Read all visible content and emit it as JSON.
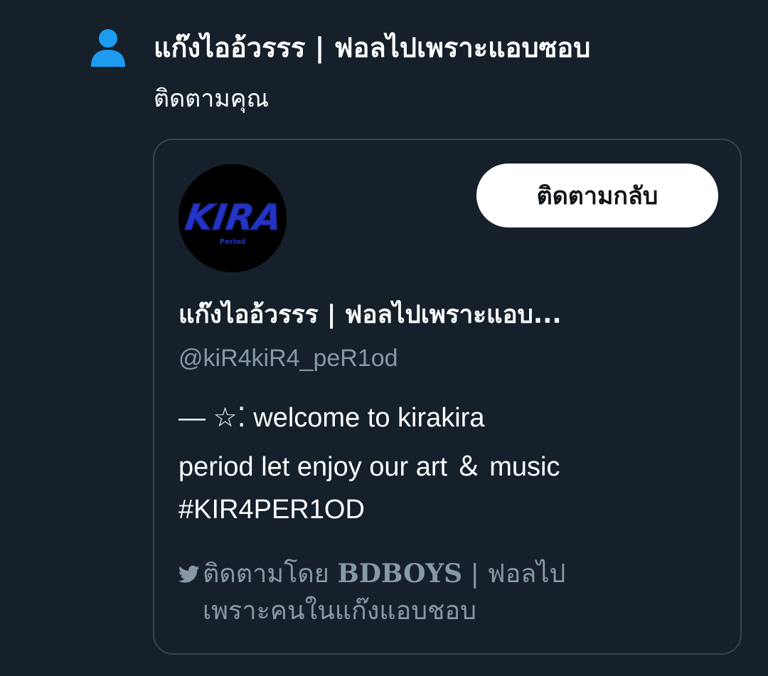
{
  "notification": {
    "icon": "person-icon",
    "icon_color": "#1d9bf0",
    "title": "แก๊งไออ้วรรร | ฟอลไปเพราะแอบซอบ",
    "subtitle": "ติดตามคุณ"
  },
  "card": {
    "avatar_text": "KIRA",
    "avatar_subtext": "Period",
    "avatar_text_color": "#2433c8",
    "follow_back_label": "ติดตามกลับ",
    "display_name": "แก๊งไออ้วรรร | ฟอลไปเพราะแอบ...",
    "handle": "@kiR4kiR4_peR1od",
    "bio": [
      "— ☆⁚ welcome to kirakira",
      "period let enjoy our art ＆ music",
      "#KIR4PER1OD"
    ],
    "followed_by": {
      "icon": "bird-icon",
      "prefix": "ติดตามโดย",
      "name": "BDBOYS",
      "suffix_line1": "| ฟอลไป",
      "line2": "เพราะคนในแก๊งแอบชอบ"
    }
  },
  "colors": {
    "background": "#15202b",
    "border": "#38444d",
    "muted_text": "#8899a6",
    "accent": "#1d9bf0"
  }
}
